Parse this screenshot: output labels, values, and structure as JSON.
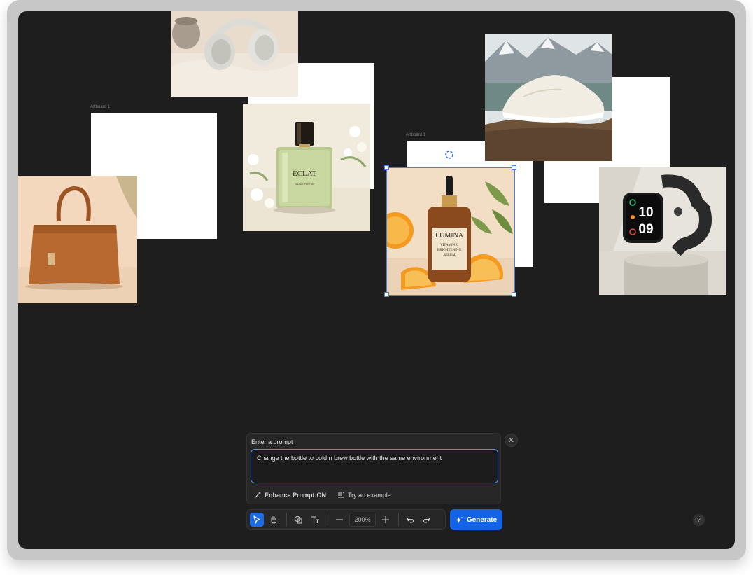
{
  "artboards": {
    "label_1": "Artboard 1",
    "label_2": "Artboard 1"
  },
  "images": {
    "headphones": "headphones-photo",
    "perfume": {
      "brand": "ÉCLAT",
      "sub": "EAU DE PARFUM"
    },
    "sneaker": "sneaker-photo",
    "handbag": "handbag-photo",
    "serum": {
      "brand": "LUMINA",
      "line1": "VITAMIN C",
      "line2": "BRIGHTENING",
      "line3": "SERUM"
    },
    "watch": {
      "hour": "10",
      "minute": "09"
    }
  },
  "prompt": {
    "title": "Enter a prompt",
    "value": "Change the bottle to cold n brew bottle with the same environment",
    "enhance_label": "Enhance Prompt:ON",
    "example_label": "Try an example"
  },
  "toolbar": {
    "zoom": "200%",
    "generate_label": "Generate"
  },
  "help_label": "?",
  "colors": {
    "accent": "#1463e6",
    "canvas": "#1e1e1e",
    "selection": "#3b82f6"
  }
}
